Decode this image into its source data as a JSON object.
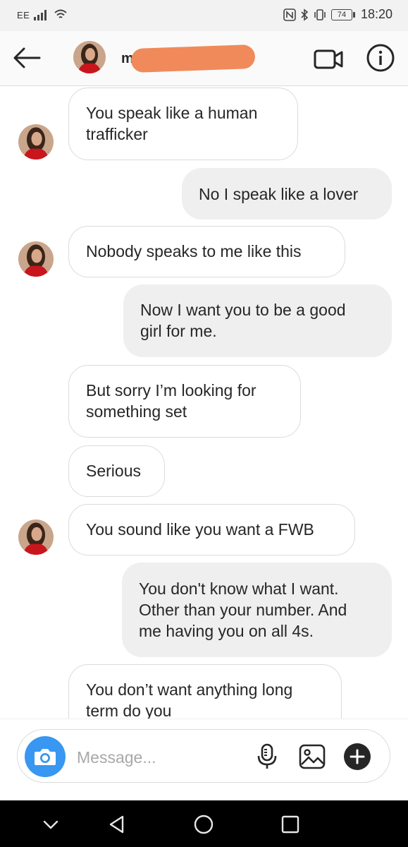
{
  "status_bar": {
    "carrier": "EE",
    "battery": "74",
    "time": "18:20"
  },
  "header": {
    "username": "m",
    "icons": [
      "back-arrow-icon",
      "video-camera-icon",
      "info-icon"
    ]
  },
  "messages": [
    {
      "direction": "in",
      "lines": [
        "You speak like a human",
        "trafficker"
      ],
      "avatar": true
    },
    {
      "direction": "out",
      "lines": [
        "No I speak like a lover"
      ]
    },
    {
      "direction": "in",
      "lines": [
        "Nobody speaks to me like this"
      ],
      "avatar": true
    },
    {
      "direction": "out",
      "lines": [
        "Now I want you to be a good",
        "girl for me."
      ]
    },
    {
      "direction": "in",
      "lines": [
        "But sorry I’m looking for",
        "something set"
      ]
    },
    {
      "direction": "in",
      "lines": [
        "Serious"
      ]
    },
    {
      "direction": "in",
      "lines": [
        "You sound like you want a FWB"
      ],
      "avatar": true
    },
    {
      "direction": "out",
      "lines": [
        "You don't know what I want.",
        "Other than your number. And",
        "me having you on all 4s."
      ]
    },
    {
      "direction": "in",
      "lines": [
        "You don’t want anything long",
        "term do you"
      ]
    }
  ],
  "composer": {
    "placeholder": "Message...",
    "accent": "#3897f0"
  },
  "nav_bar": {
    "icons": [
      "chevron-down-icon",
      "back-triangle-icon",
      "home-circle-icon",
      "recents-square-icon"
    ]
  }
}
